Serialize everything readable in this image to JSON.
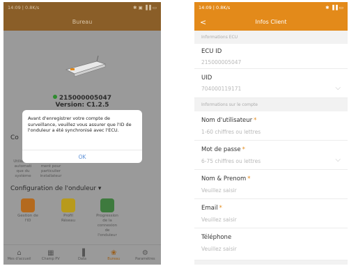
{
  "left": {
    "status": {
      "time": "14:09 | 0.8K/s",
      "icons": "❄ ☎ ▣",
      "right": "✱ ▣ ▐▐ ▭"
    },
    "title": "Bureau",
    "ecu_id": "215000005047",
    "version": "Version: C1.2.5",
    "behind_text_1": "Co",
    "behind_small_1": "Utilisation\nautomati\nque du\nsystème",
    "behind_small_2": "Enregistre\nment pour\nparticulier\ninstallateur",
    "config_title": "Configuration de l'onduleur ▾",
    "cfg_items": [
      {
        "label": "Gestion de\nl'ID"
      },
      {
        "label": "Profil\nRéseau"
      },
      {
        "label": "Progression\nde la\nconnexion\nde\nl'onduleur"
      }
    ],
    "tabs": [
      {
        "icon": "⌂",
        "label": "Mes d'accueil"
      },
      {
        "icon": "▦",
        "label": "Champ PV"
      },
      {
        "icon": "▐",
        "label": "Data"
      },
      {
        "icon": "❀",
        "label": "Bureau"
      },
      {
        "icon": "⚙",
        "label": "Paramètres"
      }
    ],
    "dialog": {
      "message": "Avant d'enregistrer votre compte de surveillance, veuillez vous assurer que l'ID de l'onduleur a été synchronisé avec l'ECU.",
      "ok": "OK"
    }
  },
  "right": {
    "status": {
      "time": "14:09 | 0.8K/s",
      "icons": "❄ ☎ ▣",
      "right": "✱ ▐▐ ▭"
    },
    "back": "<",
    "title": "Infos Client",
    "section_ecu": "Informations ECU",
    "ecu_label": "ECU ID",
    "ecu_value": "215000005047",
    "uid_label": "UID",
    "uid_value": "704000119171",
    "section_account": "Informations sur le compte",
    "user_label": "Nom d'utilisateur",
    "user_placeholder": "1-60 chiffres ou lettres",
    "pass_label": "Mot de passe",
    "pass_placeholder": "6-75 chiffres ou lettres",
    "name_label": "Nom & Prenom",
    "name_placeholder": "Veuillez saisir",
    "email_label": "Email",
    "email_placeholder": "Veuillez saisir",
    "phone_label": "Téléphone",
    "phone_placeholder": "Veuillez saisir",
    "required_mark": "*"
  },
  "colors": {
    "accent": "#e38a1a",
    "ok_blue": "#5b8fd6"
  }
}
